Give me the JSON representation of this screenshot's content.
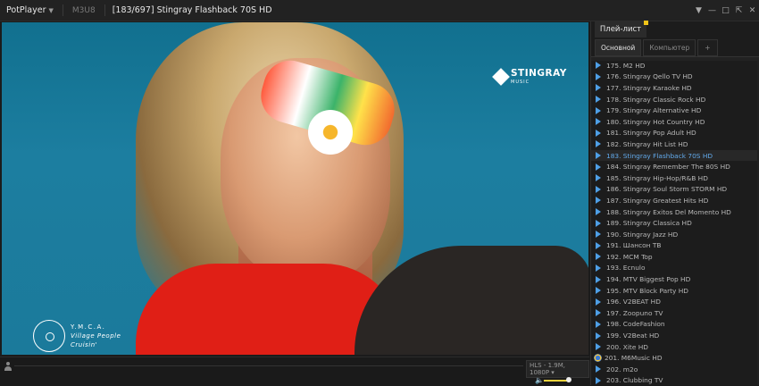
{
  "titlebar": {
    "app_name": "PotPlayer",
    "format": "M3U8",
    "title": "[183/697] Stingray Flashback 70S HD"
  },
  "overlay": {
    "logo_brand": "STINGRAY",
    "logo_sub": "MUSIC",
    "song_title": "Y.M.C.A.",
    "song_artist": "Village People",
    "song_album": "Cruisin'"
  },
  "controls": {
    "stream_info": "HLS - 1.9M, 1080P"
  },
  "panel": {
    "title": "Плей-лист",
    "tabs": [
      "Основной",
      "Компьютер",
      "+"
    ],
    "active_tab": 0,
    "items": [
      {
        "label": "175. M2 HD"
      },
      {
        "label": "176. Stingray Qello TV HD"
      },
      {
        "label": "177. Stingray Karaoke HD"
      },
      {
        "label": "178. Stingray Classic Rock HD"
      },
      {
        "label": "179. Stingray Alternative HD"
      },
      {
        "label": "180. Stingray Hot Country HD"
      },
      {
        "label": "181. Stingray Pop Adult HD"
      },
      {
        "label": "182. Stingray Hit List HD"
      },
      {
        "label": "183. Stingray Flashback 70S HD",
        "active": true
      },
      {
        "label": "184. Stingray Remember The 80S HD"
      },
      {
        "label": "185. Stingray Hip-Hop/R&B HD"
      },
      {
        "label": "186. Stingray Soul Storm STORM HD"
      },
      {
        "label": "187. Stingray Greatest Hits HD"
      },
      {
        "label": "188. Stingray Exitos Del Momento HD"
      },
      {
        "label": "189. Stingray Classica HD"
      },
      {
        "label": "190. Stingray Jazz HD"
      },
      {
        "label": "191. Шансон ТВ"
      },
      {
        "label": "192. MCM Top"
      },
      {
        "label": "193. Ecnulo"
      },
      {
        "label": "194. MTV Biggest Pop HD"
      },
      {
        "label": "195. MTV Block Party HD"
      },
      {
        "label": "196. V2BEAT HD"
      },
      {
        "label": "197. Zoopuno TV"
      },
      {
        "label": "198. CodeFashion"
      },
      {
        "label": "199. V2Beat HD"
      },
      {
        "label": "200. Xite HD"
      },
      {
        "label": "201. M6Music HD",
        "icon": "ie-icon"
      },
      {
        "label": "202. m2o"
      },
      {
        "label": "203. Clubbing TV"
      }
    ]
  },
  "colors": {
    "accent": "#62a9ea",
    "volume": "#f2d33c",
    "tab_notch": "#f0c419"
  }
}
